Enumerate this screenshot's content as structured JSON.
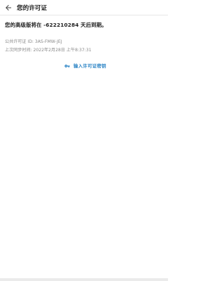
{
  "appbar": {
    "title": "您的许可证",
    "back_icon": "arrow-left-icon"
  },
  "license": {
    "expiry_text": "您的高级版将在 -622210284 天后到期。",
    "public_key_line": "公共许可证 ID: 3AS-FMW-JEJ",
    "last_sync_line": "上次同步时间: 2022年2月28日 上午8:37:31",
    "enter_key_label": "输入许可证密钥",
    "enter_key_icon": "key-icon"
  },
  "colors": {
    "accent": "#2f86c6",
    "meta_text": "#8a8a8a"
  }
}
